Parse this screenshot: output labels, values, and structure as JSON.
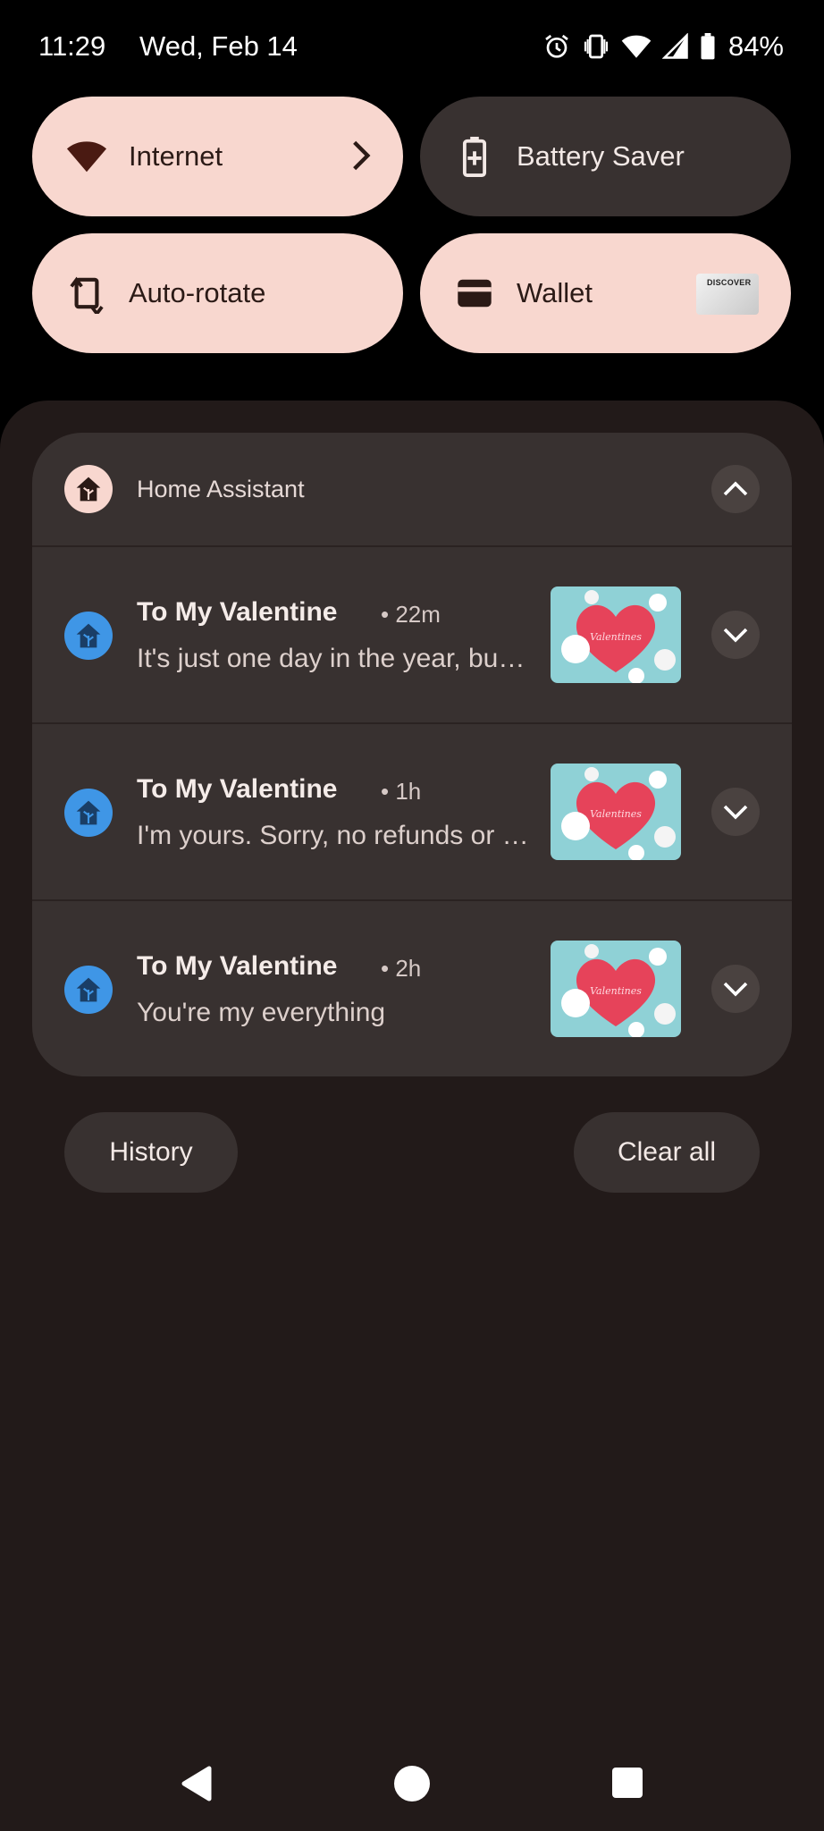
{
  "status_bar": {
    "time": "11:29",
    "date": "Wed, Feb 14",
    "battery": "84%",
    "icons": [
      "alarm-icon",
      "vibrate-icon",
      "wifi-icon",
      "cell-signal-icon",
      "battery-icon"
    ]
  },
  "quick_tiles": [
    {
      "label": "Internet",
      "state": "on",
      "icon": "wifi-icon"
    },
    {
      "label": "Battery Saver",
      "state": "off",
      "icon": "battery-saver-icon"
    },
    {
      "label": "Auto-rotate",
      "state": "on",
      "icon": "rotate-icon"
    },
    {
      "label": "Wallet",
      "state": "on",
      "icon": "wallet-icon",
      "card_brand": "DISCOVER"
    }
  ],
  "notification_group": {
    "app_name": "Home Assistant",
    "notifications": [
      {
        "title": "To My Valentine",
        "time": "22m",
        "text": "It's just one day in the year, but every day I love you more",
        "image": "valentines-card"
      },
      {
        "title": "To My Valentine",
        "time": "1h",
        "text": "I'm yours. Sorry, no refunds or exchanges",
        "image": "valentines-card"
      },
      {
        "title": "To My Valentine",
        "time": "2h",
        "text": "You're my everything",
        "image": "valentines-card"
      }
    ]
  },
  "actions": {
    "history_label": "History",
    "clear_all_label": "Clear all"
  },
  "colors": {
    "tile_on": "#f8d7cf",
    "tile_off": "#383130",
    "shade_bg": "#221a19",
    "ha_blue": "#3f96e6"
  }
}
